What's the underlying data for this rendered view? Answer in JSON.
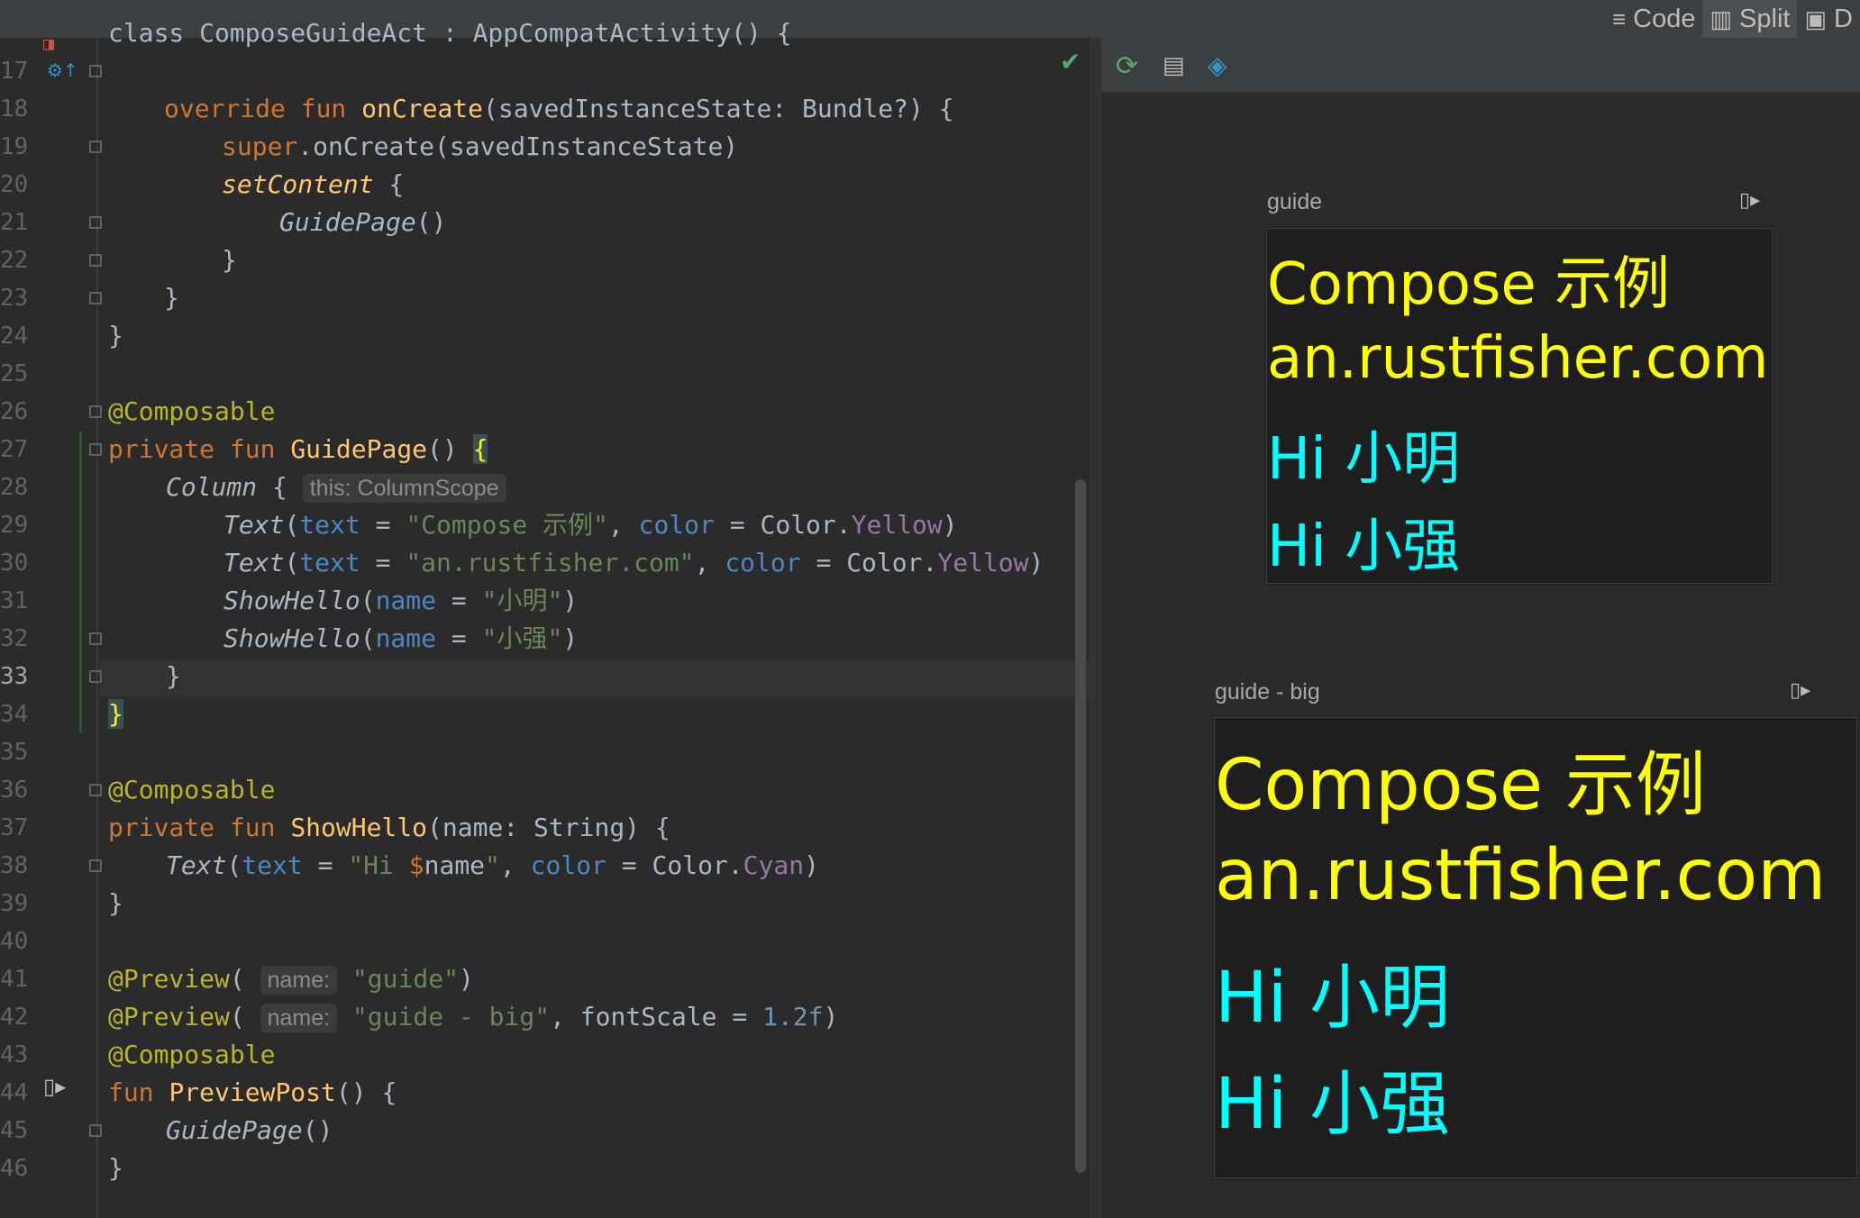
{
  "mode_tabs": [
    {
      "icon": "≡",
      "label": "Code"
    },
    {
      "icon": "▥",
      "label": "Split"
    },
    {
      "icon": "▣",
      "label": "D"
    }
  ],
  "editor": {
    "line_numbers": [
      "17",
      "18",
      "19",
      "20",
      "21",
      "22",
      "23",
      "24",
      "25",
      "26",
      "27",
      "28",
      "29",
      "30",
      "31",
      "32",
      "33",
      "34",
      "35",
      "36",
      "37",
      "38",
      "39",
      "40",
      "41",
      "42",
      "43",
      "44",
      "45",
      "46"
    ],
    "current_line": "33",
    "partial_top_line": "class ComposeGuideAct : AppCompatActivity() {",
    "hints": {
      "column_scope": "this: ColumnScope",
      "name_param": "name:"
    },
    "tokens": {
      "l17": [
        "override",
        " ",
        "fun",
        " ",
        "onCreate",
        "(savedInstanceState: Bundle?) {"
      ],
      "l18": [
        "super",
        ".onCreate(savedInstanceState)"
      ],
      "l19": [
        "setContent",
        " {"
      ],
      "l20": [
        "GuidePage",
        "()"
      ],
      "l21": [
        "}"
      ],
      "l22": [
        "}"
      ],
      "l23": [
        "}"
      ],
      "l25": [
        "@Composable"
      ],
      "l26": [
        "private",
        " ",
        "fun",
        " ",
        "GuidePage",
        "() ",
        "{"
      ],
      "l27": [
        "Column",
        " { "
      ],
      "l28": [
        "Text",
        "(",
        "text",
        " = ",
        "\"Compose 示例\"",
        ", ",
        "color",
        " = Color.",
        "Yellow",
        ")"
      ],
      "l29": [
        "Text",
        "(",
        "text",
        " = ",
        "\"an.rustfisher.com\"",
        ", ",
        "color",
        " = Color.",
        "Yellow",
        ")"
      ],
      "l30": [
        "ShowHello",
        "(",
        "name",
        " = ",
        "\"小明\"",
        ")"
      ],
      "l31": [
        "ShowHello",
        "(",
        "name",
        " = ",
        "\"小强\"",
        ")"
      ],
      "l32": [
        "}"
      ],
      "l33": [
        "}"
      ],
      "l35": [
        "@Composable"
      ],
      "l36": [
        "private",
        " ",
        "fun",
        " ",
        "ShowHello",
        "(name: String) {"
      ],
      "l37": [
        "Text",
        "(",
        "text",
        " = ",
        "\"Hi ",
        "$",
        "name",
        "\"",
        ", ",
        "color",
        " = Color.",
        "Cyan",
        ")"
      ],
      "l38": [
        "}"
      ],
      "l40": [
        "@Preview",
        "( ",
        "\"guide\"",
        ")"
      ],
      "l41": [
        "@Preview",
        "( ",
        "\"guide - big\"",
        ", fontScale = ",
        "1.2f",
        ")"
      ],
      "l42": [
        "@Composable"
      ],
      "l43": [
        "fun",
        " ",
        "PreviewPost",
        "() {"
      ],
      "l44": [
        "GuidePage",
        "()"
      ],
      "l45": [
        "}"
      ]
    }
  },
  "preview": {
    "colors": {
      "yellow": "#ffff00",
      "cyan": "#00ffff",
      "frame_bg": "#1e1e1e"
    },
    "toolbar_icons": [
      "refresh-icon",
      "layout-icon",
      "layers-icon"
    ],
    "previews": [
      {
        "label": "guide",
        "lines": [
          "Compose 示例",
          "an.rustfisher.com",
          "Hi 小明",
          "Hi 小强"
        ]
      },
      {
        "label": "guide - big",
        "lines": [
          "Compose 示例",
          "an.rustfisher.com",
          "Hi 小明",
          "Hi 小强"
        ]
      }
    ]
  }
}
